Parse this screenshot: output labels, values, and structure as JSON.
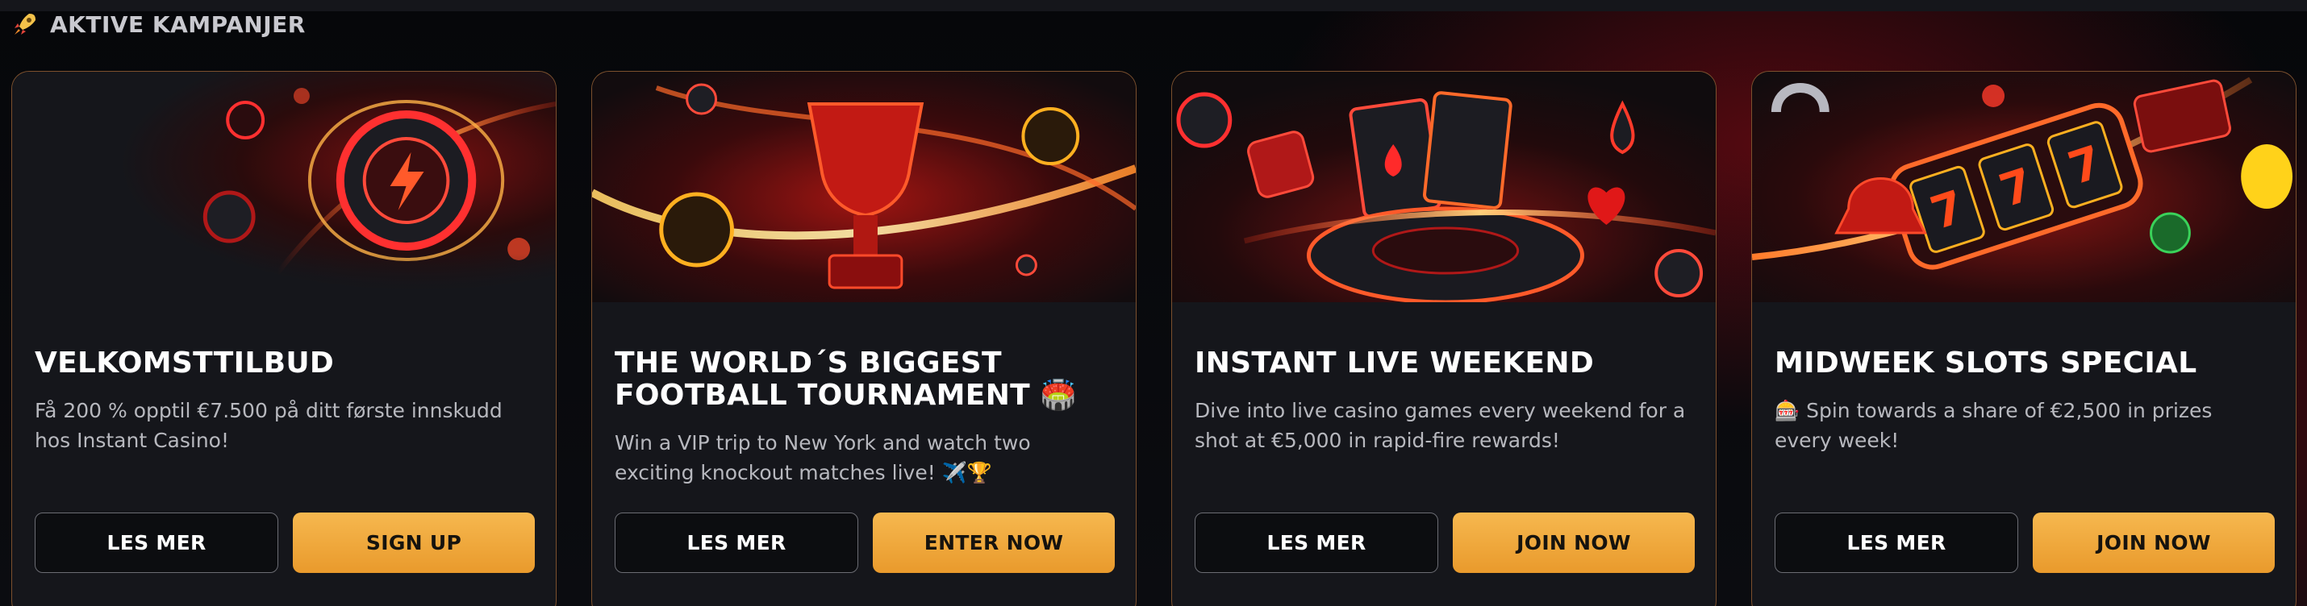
{
  "section": {
    "title": "AKTIVE KAMPANJER",
    "icon": "rocket-icon"
  },
  "colors": {
    "accent": "#F0A93D",
    "card_border": "#D2823C",
    "background": "#08090C",
    "card_bg": "#15161B"
  },
  "cards": [
    {
      "art": "poker-chip-lightning-art",
      "title": "VELKOMSTTILBUD",
      "description": "Få 200 % opptil €7.500 på ditt første innskudd hos Instant Casino!",
      "secondary_label": "LES MER",
      "primary_label": "SIGN UP"
    },
    {
      "art": "trophy-footballs-art",
      "title": "THE WORLD´S BIGGEST FOOTBALL TOURNAMENT 🏟️",
      "description": "Win a VIP trip to New York and watch two exciting knockout matches live! ✈️🏆",
      "secondary_label": "LES MER",
      "primary_label": "ENTER NOW"
    },
    {
      "art": "roulette-cards-art",
      "title": "INSTANT LIVE WEEKEND",
      "description": "Dive into live casino games every weekend for a shot at €5,000 in rapid-fire rewards!",
      "secondary_label": "LES MER",
      "primary_label": "JOIN NOW"
    },
    {
      "art": "slot-machine-777-art",
      "title": "MIDWEEK SLOTS SPECIAL",
      "description": "🎰 Spin towards a share of €2,500 in prizes every week!",
      "secondary_label": "LES MER",
      "primary_label": "JOIN NOW"
    }
  ]
}
